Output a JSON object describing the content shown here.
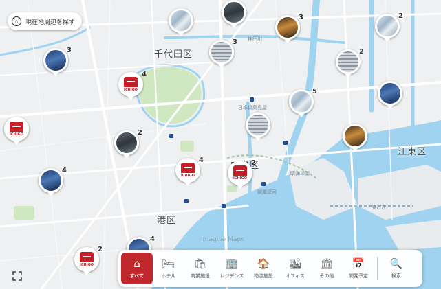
{
  "map": {
    "locate_button_label": "現在地周辺を探す",
    "ward_labels": [
      "千代田区",
      "中央区",
      "港区",
      "江東区"
    ],
    "small_labels": [
      "神田川",
      "日本橋高島屋",
      "晴海埠頭",
      "朝潮運河",
      "勝どき"
    ],
    "watermark": "Imagine Maps",
    "water_color": "#9fd3f0",
    "park_color": "#cfe8c2",
    "road_color": "#ffffff",
    "brand_color": "#c0282d",
    "brand_logo_text": "ICHIGO"
  },
  "pins": [
    {
      "type": "building",
      "count": "",
      "style": "glass"
    },
    {
      "type": "building",
      "count": "",
      "style": "dark"
    },
    {
      "type": "building",
      "count": "3",
      "style": "night"
    },
    {
      "type": "building",
      "count": "2",
      "style": "glass"
    },
    {
      "type": "building",
      "count": "3",
      "style": "blue"
    },
    {
      "type": "building",
      "count": "3",
      "style": "grey"
    },
    {
      "type": "building",
      "count": "2",
      "style": "grey"
    },
    {
      "type": "ichigo",
      "count": "4"
    },
    {
      "type": "building",
      "count": "",
      "style": "blue"
    },
    {
      "type": "building",
      "count": "5",
      "style": "glass"
    },
    {
      "type": "ichigo",
      "count": ""
    },
    {
      "type": "building",
      "count": "",
      "style": "grey"
    },
    {
      "type": "building",
      "count": "2",
      "style": "dark"
    },
    {
      "type": "building",
      "count": "",
      "style": "night"
    },
    {
      "type": "ichigo",
      "count": "4"
    },
    {
      "type": "ichigo",
      "count": "2"
    },
    {
      "type": "building",
      "count": "4",
      "style": "blue"
    },
    {
      "type": "ichigo",
      "count": "2"
    },
    {
      "type": "building",
      "count": "4",
      "style": "blue"
    }
  ],
  "toolbar": {
    "items": [
      {
        "label": "すべて",
        "icon": "home-icon",
        "glyph": "⌂",
        "active": true
      },
      {
        "label": "ホテル",
        "icon": "bed-icon",
        "glyph": "🛏",
        "active": false
      },
      {
        "label": "商業施設",
        "icon": "shopping-bag-icon",
        "glyph": "🛍",
        "active": false
      },
      {
        "label": "レジデンス",
        "icon": "residence-icon",
        "glyph": "🏢",
        "active": false
      },
      {
        "label": "物流施設",
        "icon": "warehouse-icon",
        "glyph": "🏠",
        "active": false
      },
      {
        "label": "オフィス",
        "icon": "office-icon",
        "glyph": "🏙",
        "active": false
      },
      {
        "label": "その他",
        "icon": "other-icon",
        "glyph": "🏛",
        "active": false
      },
      {
        "label": "開発予定",
        "icon": "calendar-icon",
        "glyph": "📅",
        "active": false
      }
    ],
    "search_label": "検索",
    "search_glyph": "🔍"
  }
}
